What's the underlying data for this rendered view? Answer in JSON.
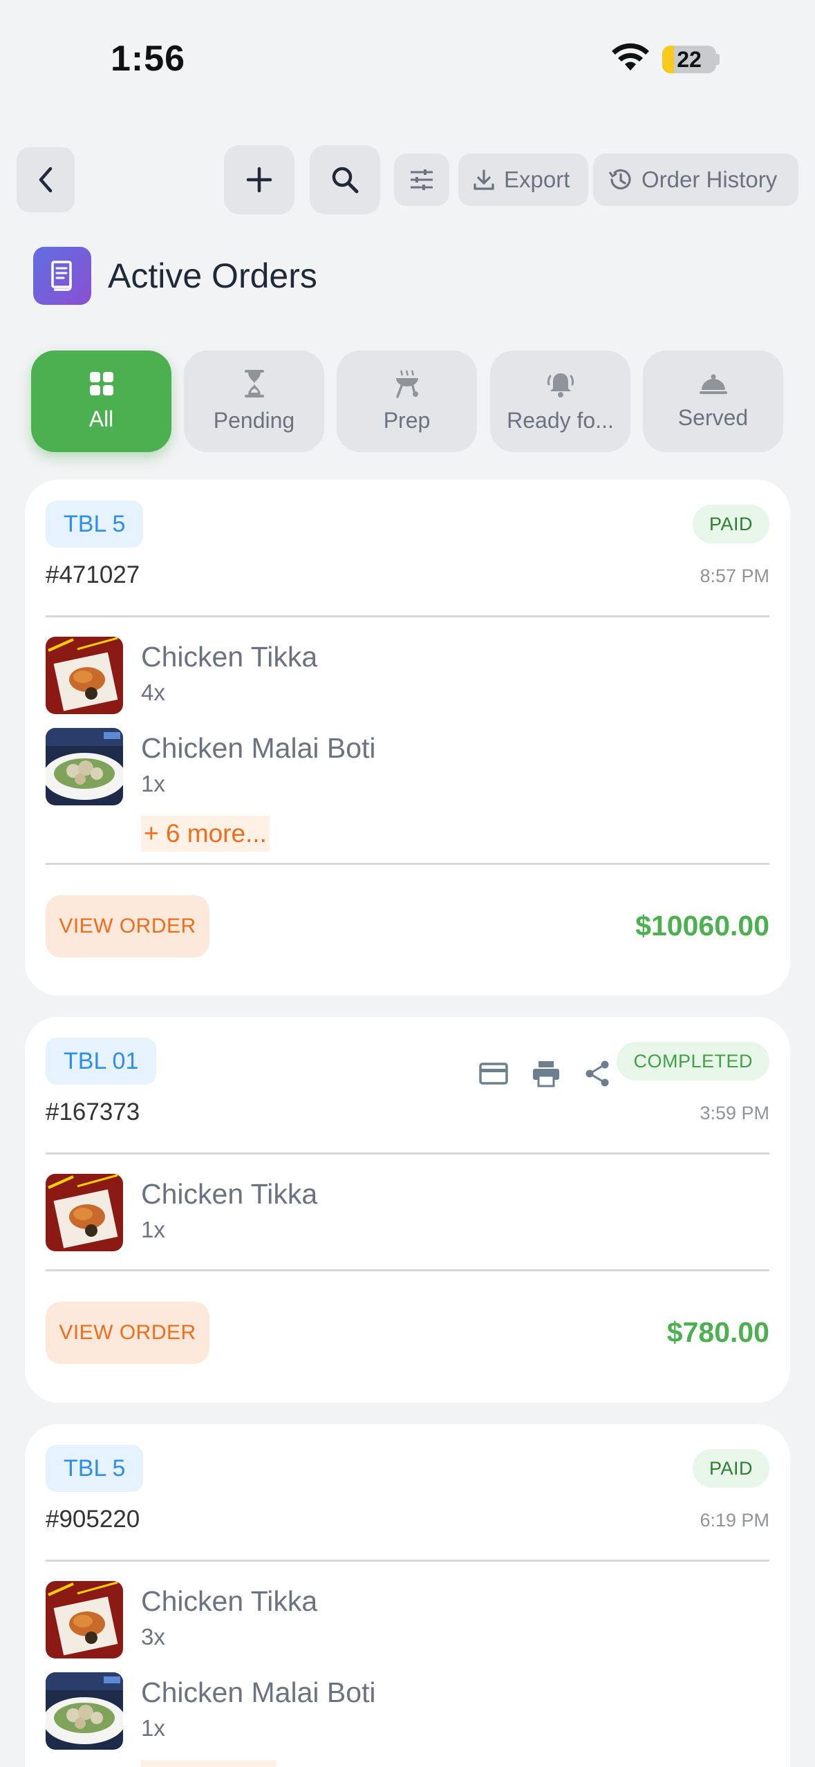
{
  "status_bar": {
    "time": "1:56",
    "battery": "22",
    "battery_level": 0.22
  },
  "toolbar": {
    "back_icon": "chevron-left-icon",
    "add_icon": "plus-icon",
    "search_icon": "search-icon",
    "filter_icon": "sliders-icon",
    "export_label": "Export",
    "history_label": "Order History"
  },
  "header": {
    "title": "Active Orders",
    "icon": "receipt-icon"
  },
  "tabs": [
    {
      "label": "All",
      "icon": "grid-icon",
      "active": true
    },
    {
      "label": "Pending",
      "icon": "hourglass-icon",
      "active": false
    },
    {
      "label": "Prep",
      "icon": "grill-icon",
      "active": false
    },
    {
      "label": "Ready fo...",
      "icon": "bell-icon",
      "active": false
    },
    {
      "label": "Served",
      "icon": "cloche-icon",
      "active": false
    }
  ],
  "orders": [
    {
      "table": "TBL 5",
      "status": "PAID",
      "id": "#471027",
      "time": "8:57 PM",
      "items": [
        {
          "name": "Chicken Tikka",
          "qty": "4x"
        },
        {
          "name": "Chicken Malai Boti",
          "qty": "1x"
        }
      ],
      "more": "+ 6 more...",
      "view_label": "VIEW ORDER",
      "total": "$10060.00"
    },
    {
      "table": "TBL 01",
      "status": "COMPLETED",
      "id": "#167373",
      "time": "3:59 PM",
      "items": [
        {
          "name": "Chicken Tikka",
          "qty": "1x"
        }
      ],
      "view_label": "VIEW ORDER",
      "total": "$780.00"
    },
    {
      "table": "TBL 5",
      "status": "PAID",
      "id": "#905220",
      "time": "6:19 PM",
      "items": [
        {
          "name": "Chicken Tikka",
          "qty": "3x"
        },
        {
          "name": "Chicken Malai Boti",
          "qty": "1x"
        }
      ]
    }
  ],
  "colors": {
    "accent_green": "#4caf50",
    "accent_orange": "#f06d1a",
    "badge_blue": "#2f8ee6"
  }
}
